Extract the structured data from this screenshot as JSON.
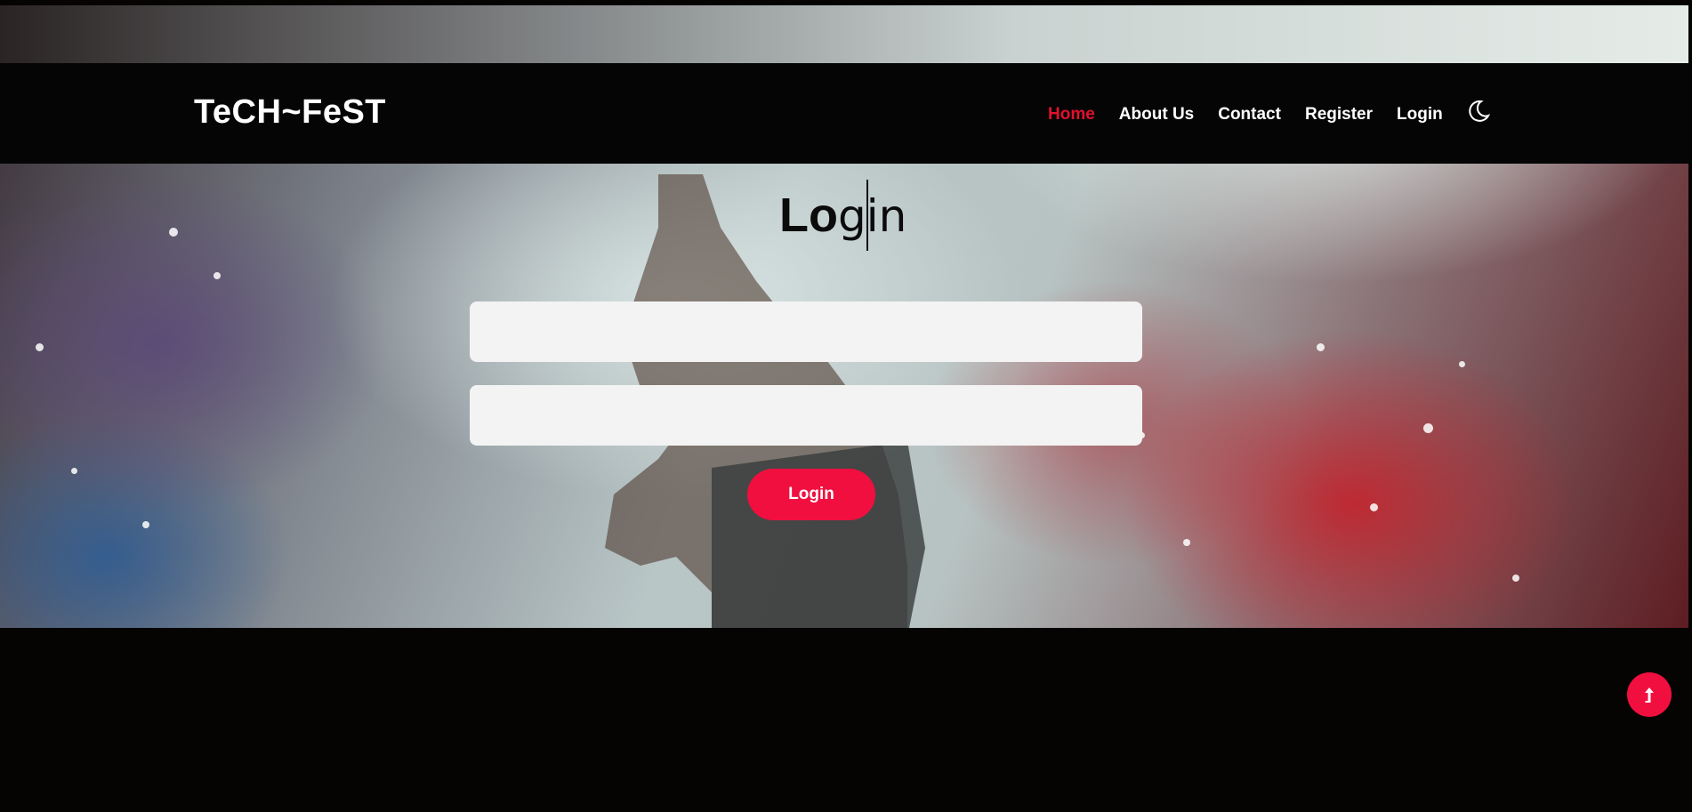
{
  "navbar": {
    "brand": "TeCH~FeST",
    "links": [
      {
        "label": "Home",
        "active": true
      },
      {
        "label": "About Us",
        "active": false
      },
      {
        "label": "Contact",
        "active": false
      },
      {
        "label": "Register",
        "active": false
      },
      {
        "label": "Login",
        "active": false
      }
    ],
    "theme_toggle_icon": "moon-icon"
  },
  "login_form": {
    "title_bold": "Lo",
    "title_thin": "gin",
    "username_value": "",
    "password_value": "",
    "submit_label": "Login"
  },
  "scroll_top": {
    "icon": "arrow-up-icon"
  },
  "colors": {
    "accent": "#f10f40",
    "active_link": "#e3102d",
    "navbar_bg": "#050506",
    "field_bg": "#f3f3f3",
    "footer_bg": "#060402"
  }
}
